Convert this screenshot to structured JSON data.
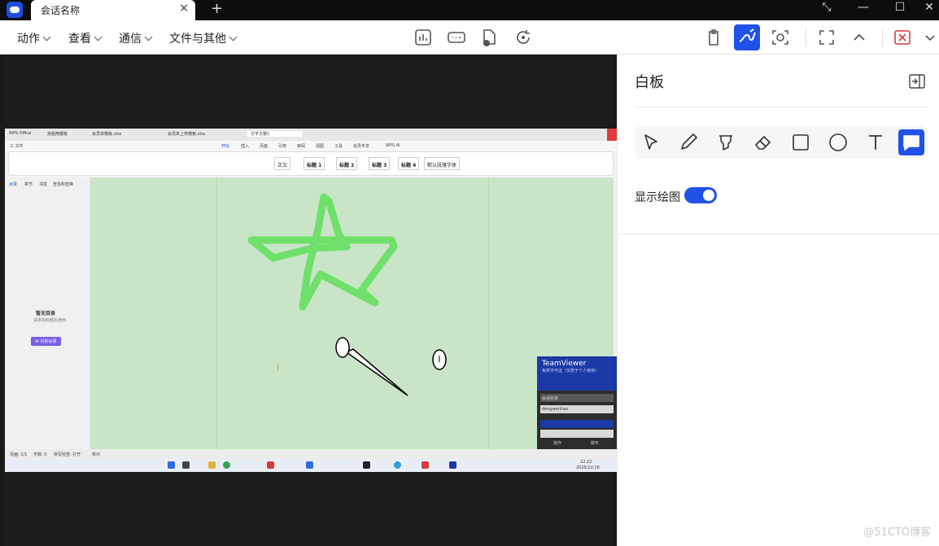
{
  "window": {
    "tab_title": "会话名称",
    "new_tab": "+",
    "tab_close": "×",
    "controls": {
      "shrink": "⤡",
      "minimize": "—",
      "maximize": "☐",
      "close": "✕"
    }
  },
  "menu": {
    "items": [
      {
        "label": "动作"
      },
      {
        "label": "查看"
      },
      {
        "label": "通信"
      },
      {
        "label": "文件与其他"
      }
    ],
    "center_tools": [
      "dashboard-icon",
      "remote-input-icon",
      "file-transfer-icon",
      "reboot-icon"
    ],
    "right_tools": [
      "clipboard-icon",
      "whiteboard-icon",
      "screenshot-icon",
      "fullscreen-icon",
      "collapse-icon",
      "end-session-icon",
      "more-chevron-icon"
    ]
  },
  "remote_screen": {
    "wps_tabs": [
      "WPS Office",
      "找稻壳模板",
      "会员单模板.xlsx",
      "会员单上传模板.xlsx",
      "文字文稿1"
    ],
    "wps_menu": [
      "三 文件",
      "开始",
      "插入",
      "页面",
      "引用",
      "审阅",
      "视图",
      "工具",
      "会员专享",
      "WPS AI"
    ],
    "styles": [
      "正文",
      "标题 1",
      "标题 2",
      "标题 3",
      "标题 4",
      "默认段落字体"
    ],
    "side_tabs": [
      "目录",
      "章节",
      "书签",
      "查找和替换"
    ],
    "side_empty_title": "暂无目录",
    "side_empty_hint": "请添加标题后使用",
    "side_button": "AI 识别目录",
    "status": [
      "页面: 1/1",
      "字数: 0",
      "拼写检查: 打开",
      "校对"
    ],
    "teamviewer": {
      "title": "TeamViewer",
      "subtitle": "免费许可证（仅限于个人使用）",
      "session_header": "会话名单",
      "session_row": "dengwenhao",
      "footer_left": "操作",
      "footer_right": "聊天"
    },
    "taskbar_time": "22:22",
    "taskbar_date": "2025/12/16"
  },
  "whiteboard": {
    "title": "白板",
    "tools": [
      "pointer-icon",
      "pen-icon",
      "highlighter-icon",
      "eraser-icon",
      "rectangle-icon",
      "ellipse-icon",
      "text-icon",
      "comment-icon"
    ],
    "active_tool": "comment-icon",
    "show_drawing_label": "显示绘图",
    "show_drawing": true
  },
  "colors": {
    "accent": "#2152e8",
    "stroke": "#6fe06a",
    "doc_bg": "#c9e4c7"
  },
  "watermark": "@51CTO博客"
}
